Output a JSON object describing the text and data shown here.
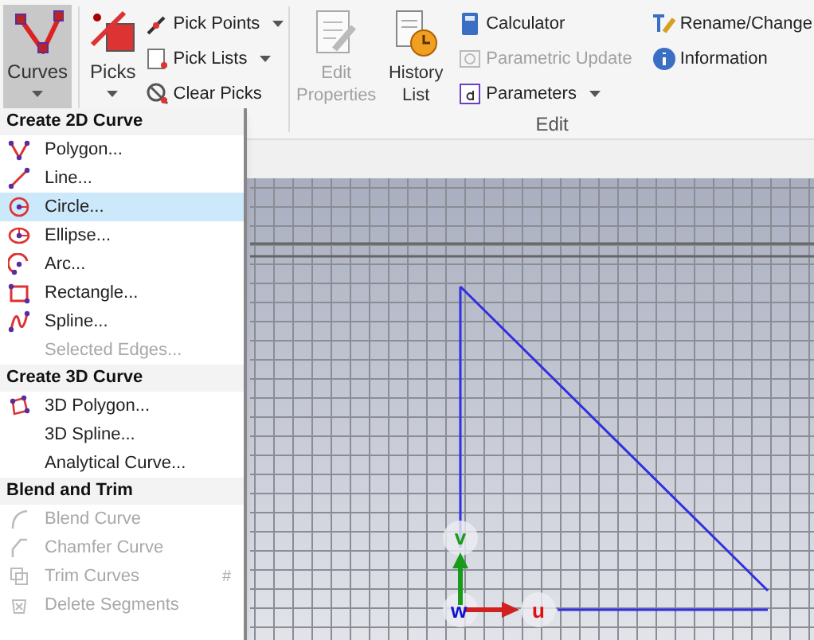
{
  "ribbon": {
    "curves_button": {
      "label": "Curves",
      "selected": true
    },
    "picks_button": {
      "label": "Picks"
    },
    "pick_tools": [
      {
        "label": "Pick Points",
        "dropdown": true
      },
      {
        "label": "Pick Lists",
        "dropdown": true
      },
      {
        "label": "Clear Picks",
        "dropdown": false
      }
    ],
    "edit_group": {
      "label": "Edit",
      "large_buttons": [
        {
          "label": "Edit Properties",
          "disabled": true
        },
        {
          "label": "History List",
          "disabled": false
        }
      ],
      "tools": [
        {
          "label": "Calculator",
          "disabled": false,
          "dropdown": false
        },
        {
          "label": "Parametric Update",
          "disabled": true,
          "dropdown": false
        },
        {
          "label": "Parameters",
          "disabled": false,
          "dropdown": true
        }
      ],
      "tools_2": [
        {
          "label": "Rename/Change"
        },
        {
          "label": "Information"
        }
      ]
    }
  },
  "curves_menu": [
    {
      "header": "Create 2D Curve",
      "items": [
        {
          "label": "Polygon...",
          "selected": false,
          "disabled": false
        },
        {
          "label": "Line...",
          "selected": false,
          "disabled": false
        },
        {
          "label": "Circle...",
          "selected": true,
          "disabled": false
        },
        {
          "label": "Ellipse...",
          "selected": false,
          "disabled": false
        },
        {
          "label": "Arc...",
          "selected": false,
          "disabled": false
        },
        {
          "label": "Rectangle...",
          "selected": false,
          "disabled": false
        },
        {
          "label": "Spline...",
          "selected": false,
          "disabled": false
        },
        {
          "label": "Selected Edges...",
          "selected": false,
          "disabled": true
        }
      ]
    },
    {
      "header": "Create 3D Curve",
      "items": [
        {
          "label": "3D Polygon...",
          "selected": false,
          "disabled": false
        },
        {
          "label": "3D Spline...",
          "selected": false,
          "disabled": false
        },
        {
          "label": "Analytical Curve...",
          "selected": false,
          "disabled": false
        }
      ]
    },
    {
      "header": "Blend and Trim",
      "items": [
        {
          "label": "Blend Curve",
          "selected": false,
          "disabled": true
        },
        {
          "label": "Chamfer Curve",
          "selected": false,
          "disabled": true
        },
        {
          "label": "Trim Curves",
          "selected": false,
          "disabled": true,
          "shortcut": "#"
        },
        {
          "label": "Delete Segments",
          "selected": false,
          "disabled": true
        }
      ]
    }
  ],
  "viewport": {
    "axes": {
      "v": "v",
      "u": "u",
      "w": "w"
    }
  }
}
